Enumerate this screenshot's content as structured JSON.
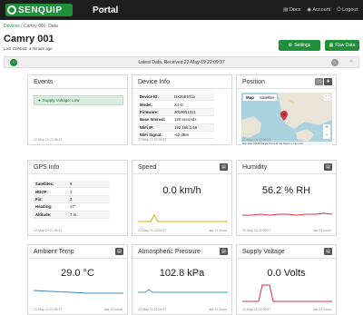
{
  "header": {
    "logo_text": "SENQUIP",
    "app_title": "Portal",
    "nav": [
      "Docs",
      "Account",
      "Logout"
    ]
  },
  "breadcrumb": {
    "root": "Devices",
    "sep": " / ",
    "current": "Camry 001: Data"
  },
  "device": {
    "name": "Camry 001",
    "last_contact": "Last Contact: a minute ago"
  },
  "buttons": {
    "settings": "Settings",
    "raw_data": "Raw Data"
  },
  "latest": {
    "text": "Latest Data. Received 22-May-19 22:09:37"
  },
  "events": {
    "title": "Events",
    "message": "Supply Voltage: Low",
    "footer": "22-May-19 22:09:37"
  },
  "device_info": {
    "title": "Device Info",
    "rows": [
      {
        "k": "Device ID:",
        "v": "DX25E5T11"
      },
      {
        "k": "Model:",
        "v": "X1-G"
      },
      {
        "k": "Firmware:",
        "v": "2019051311"
      },
      {
        "k": "Base Interval:",
        "v": "120 seconds"
      },
      {
        "k": "WiFi IP:",
        "v": "192.168.1.66"
      },
      {
        "k": "WiFi Signal:",
        "v": "-62 dBm"
      }
    ],
    "footer": "22-May-19 22:09:37"
  },
  "position": {
    "title": "Position",
    "map_tab": "Map",
    "sat_tab": "Satellite",
    "attribution": "Map data ©2019 Google   Terms of Use   Report a map error",
    "footer": "22-May-19 22:09:37"
  },
  "gps": {
    "title": "GPS Info",
    "rows": [
      {
        "k": "Satellites:",
        "v": "9"
      },
      {
        "k": "HDOP:",
        "v": "1"
      },
      {
        "k": "Fix:",
        "v": "2"
      },
      {
        "k": "Heading:",
        "v": "17°"
      },
      {
        "k": "Altitude:",
        "v": "7 m"
      }
    ],
    "footer": "22-May-19 22:09:37"
  },
  "speed": {
    "title": "Speed",
    "value": "0.0 km/h",
    "footer": "22-May-19 22:09:37",
    "footer_r": "last 24 hours"
  },
  "humidity": {
    "title": "Humidity",
    "value": "56.2 % RH",
    "footer": "22-May-19 22:09:37",
    "footer_r": "last 24 hours"
  },
  "ambient": {
    "title": "Ambient Temp",
    "value": "29.0 °C",
    "footer": "22-May-19 22:09:37",
    "footer_r": "last 24 hours"
  },
  "pressure": {
    "title": "Atmospheric Pressure",
    "value": "102.8 kPa",
    "footer": "22-May-19 22:09:37",
    "footer_r": "last 24 hours"
  },
  "voltage": {
    "title": "Supply Voltage",
    "value": "0.0 Volts",
    "footer": "22-May-19 22:09:37",
    "footer_r": "last 24 hours"
  },
  "colors": {
    "brand": "#1f8f3a",
    "topbar": "#1e1e1e",
    "chart_blue": "#3a86c8",
    "chart_yellow": "#e0a800",
    "chart_red": "#d9333f"
  }
}
